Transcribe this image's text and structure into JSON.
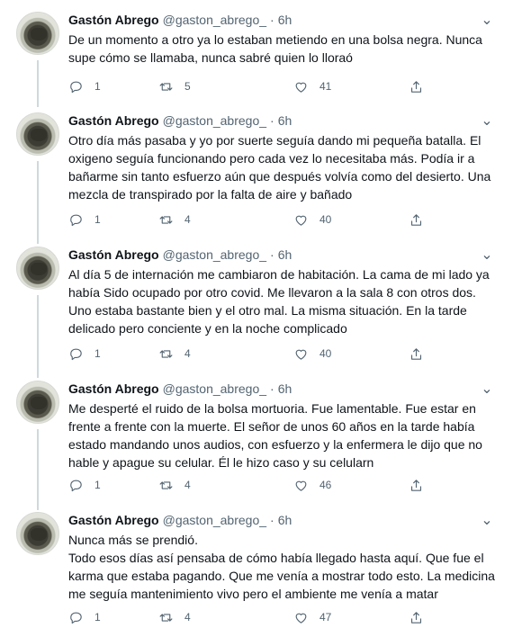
{
  "author": {
    "name": "Gastón Abrego",
    "handle": "@gaston_abrego_",
    "avatar_icon": "profile-photo"
  },
  "tweets": [
    {
      "time": "6h",
      "text": "De un momento a otro ya lo estaban metiendo en una bolsa negra. Nunca supe cómo se llamaba, nunca sabré quien lo lloraó",
      "replies": "1",
      "retweets": "5",
      "likes": "41"
    },
    {
      "time": "6h",
      "text": "Otro día más pasaba y yo por suerte seguía dando mi pequeña batalla. El oxigeno seguía funcionando pero cada vez lo necesitaba más. Podía ir a bañarme sin tanto esfuerzo aún que después volvía como del desierto. Una mezcla de transpirado por la falta de aire y bañado",
      "replies": "1",
      "retweets": "4",
      "likes": "40"
    },
    {
      "time": "6h",
      "text": "Al día 5 de internación me cambiaron de habitación. La cama de mi lado ya había Sido ocupado por otro covid. Me llevaron a la sala 8 con otros dos. Uno estaba bastante bien y el otro mal. La misma situación. En la tarde delicado pero conciente y en la noche complicado",
      "replies": "1",
      "retweets": "4",
      "likes": "40"
    },
    {
      "time": "6h",
      "text": "Me desperté el ruido de la bolsa mortuoria. Fue lamentable. Fue estar en frente a frente con la muerte. El señor de unos 60 años en la tarde había estado mandando unos audios, con esfuerzo y la enfermera le dijo que no hable y apague su celular. Él le hizo caso y su celularn",
      "replies": "1",
      "retweets": "4",
      "likes": "46"
    },
    {
      "time": "6h",
      "text": "Nunca más se prendió.\nTodo esos días así pensaba de cómo había llegado hasta aquí. Que fue el karma que estaba pagando. Que me venía a mostrar todo esto. La medicina me seguía mantenimiento vivo pero el ambiente me venía a matar",
      "replies": "1",
      "retweets": "4",
      "likes": "47"
    }
  ]
}
